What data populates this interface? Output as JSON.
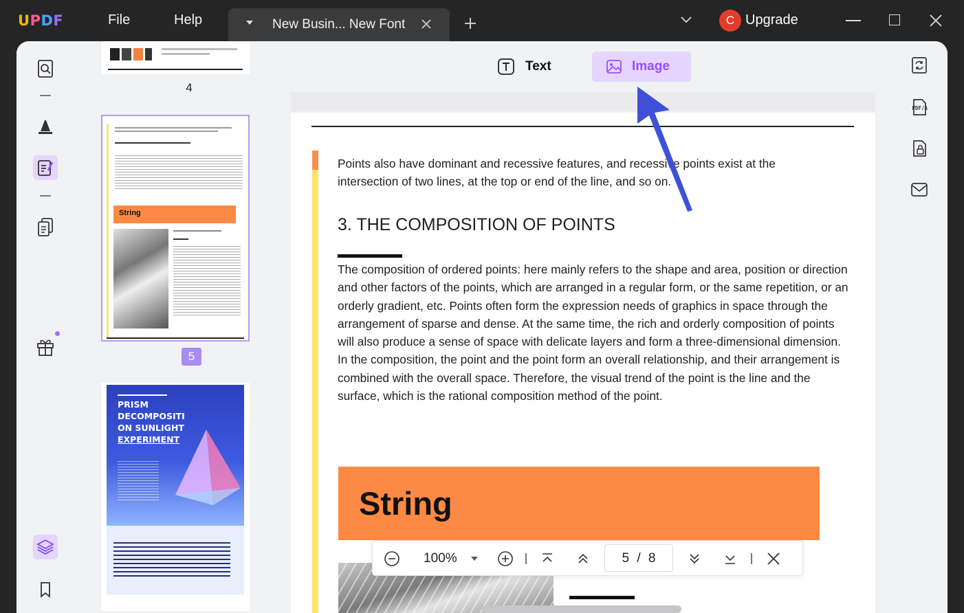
{
  "titlebar": {
    "logo_u": "U",
    "logo_p": "P",
    "logo_d": "D",
    "logo_f": "F",
    "menu": {
      "file": "File",
      "help": "Help"
    },
    "tab_title": "New Busin... New Font",
    "avatar_letter": "C",
    "upgrade": "Upgrade"
  },
  "toolbar": {
    "text_mode": "Text",
    "image_mode": "Image"
  },
  "thumbnails": {
    "page4_label": "4",
    "page5_label": "5",
    "page5_string": "String",
    "page6_title_lines": [
      "PRISM",
      "DECOMPOSITI",
      "ON SUNLIGHT",
      "EXPERIMENT"
    ]
  },
  "document": {
    "intro": "Points also have dominant and recessive features, and recessive points exist at the intersection of two lines, at the top or end of the line, and so on.",
    "heading": "3. THE COMPOSITION OF POINTS",
    "body": "The composition of ordered points: here mainly refers to the shape and area, position or direction and other factors of the points, which are arranged in a regular form, or the same repetition, or an orderly gradient, etc. Points often form the expression needs of graphics in space through the arrangement of sparse and dense. At the same time, the rich and orderly composition of points will also produce a sense of space with delicate layers and form a three-dimensional dimension. In the composition, the point and the point form an overall relationship, and their arrangement is combined with the overall space. Therefore, the visual trend of the point is the line and the surface, which is the rational composition method of the point.",
    "banner": "String"
  },
  "pager": {
    "zoom": "100%",
    "page_current": "5",
    "page_sep": "/",
    "page_total": "8"
  },
  "colors": {
    "accent_purple": "#a98cf2",
    "banner_orange": "#fd8a44",
    "arrow_blue": "#3f51d6"
  }
}
